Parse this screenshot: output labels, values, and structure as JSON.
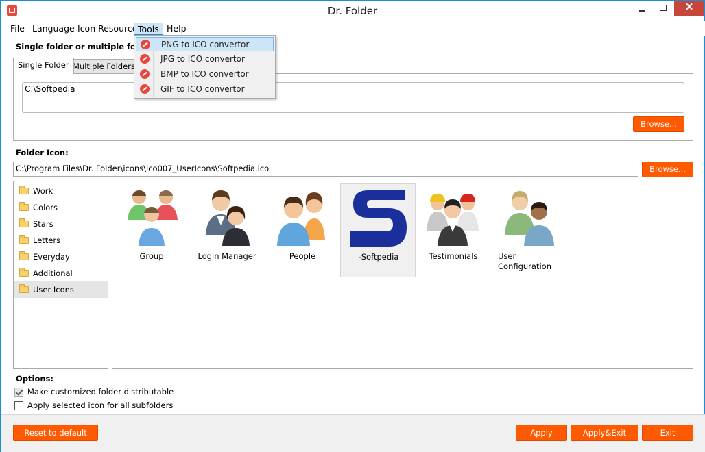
{
  "window": {
    "title": "Dr. Folder",
    "close_glyph": "✕"
  },
  "menu": {
    "file": "File",
    "language": "Language",
    "icon_resource": "Icon Resource",
    "tools": "Tools",
    "help": "Help"
  },
  "tools_menu": {
    "items": [
      "PNG to ICO convertor",
      "JPG to ICO convertor",
      "BMP to ICO convertor",
      "GIF to ICO convertor"
    ],
    "highlighted_index": 0
  },
  "folders_section": {
    "label": "Single folder or multiple folders:",
    "tabs": [
      "Single Folder",
      "Multiple Folders"
    ],
    "active_tab": 0,
    "folder_path": "C:\\Softpedia",
    "browse_label": "Browse..."
  },
  "icon_section": {
    "label": "Folder Icon:",
    "icon_path": "C:\\Program Files\\Dr. Folder\\icons\\ico007_UserIcons\\Softpedia.ico",
    "browse_label": "Browse..."
  },
  "categories": {
    "items": [
      "Work",
      "Colors",
      "Stars",
      "Letters",
      "Everyday",
      "Additional",
      "User Icons"
    ],
    "selected_index": 6
  },
  "icons": {
    "items": [
      "Group",
      "Login Manager",
      "People",
      "-Softpedia",
      "Testimonials",
      "User\nConfiguration"
    ],
    "selected_index": 3
  },
  "options": {
    "label": "Options:",
    "distributable_label": "Make customized folder distributable",
    "distributable_checked": true,
    "subfolders_label": "Apply selected icon for all subfolders",
    "subfolders_checked": false
  },
  "footer": {
    "reset_label": "Reset to default",
    "apply_label": "Apply",
    "apply_exit_label": "Apply&Exit",
    "exit_label": "Exit"
  },
  "colors": {
    "accent": "#ff5a00",
    "window_border": "#1b8cd8",
    "close_button": "#c7463c",
    "highlight": "#cde6f7"
  }
}
